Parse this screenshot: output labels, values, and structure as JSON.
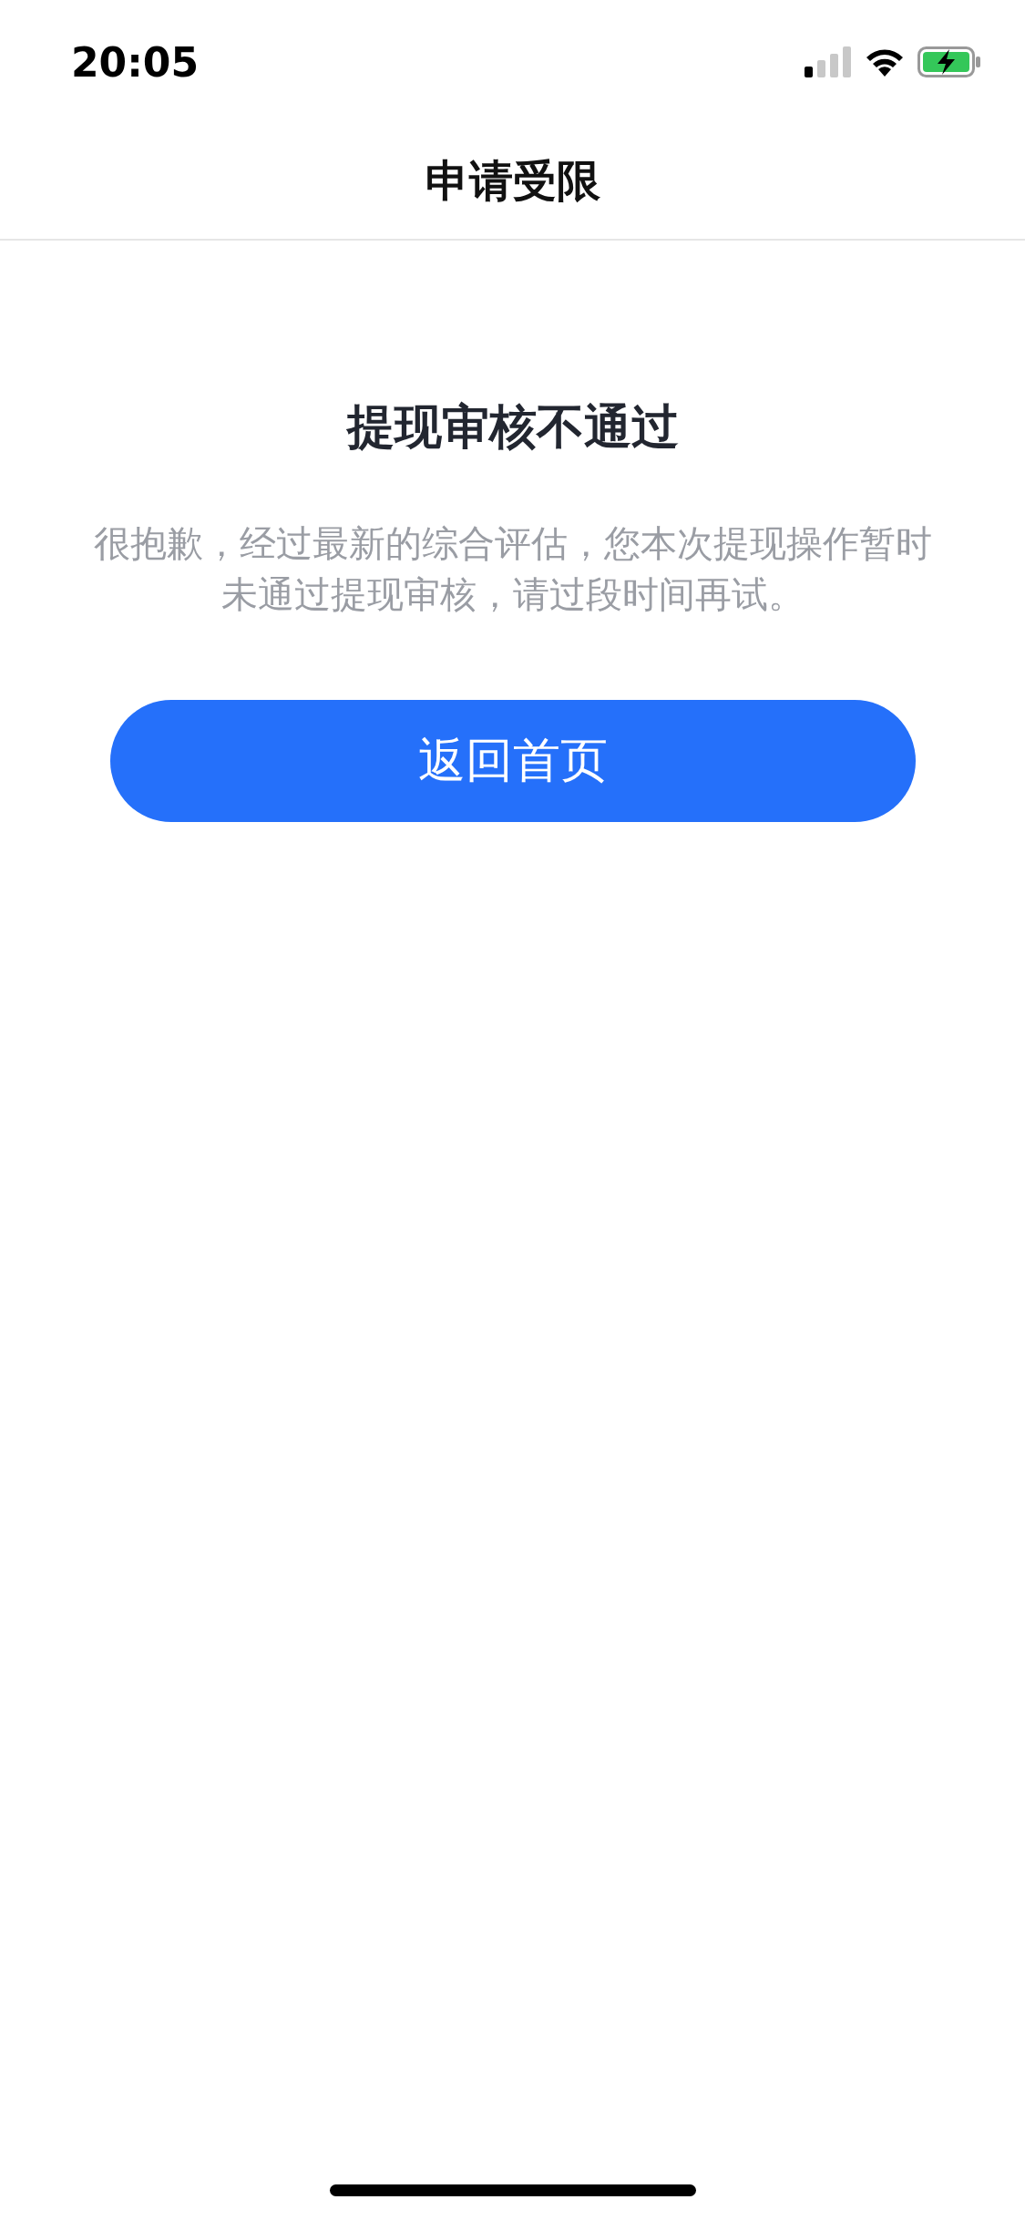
{
  "status_bar": {
    "time": "20:05"
  },
  "nav_bar": {
    "title": "申请受限"
  },
  "result": {
    "title": "提现审核不通过",
    "message": "很抱歉，经过最新的综合评估，您本次提现操作暂时未通过提现审核，请过段时间再试。"
  },
  "button": {
    "label": "返回首页"
  }
}
